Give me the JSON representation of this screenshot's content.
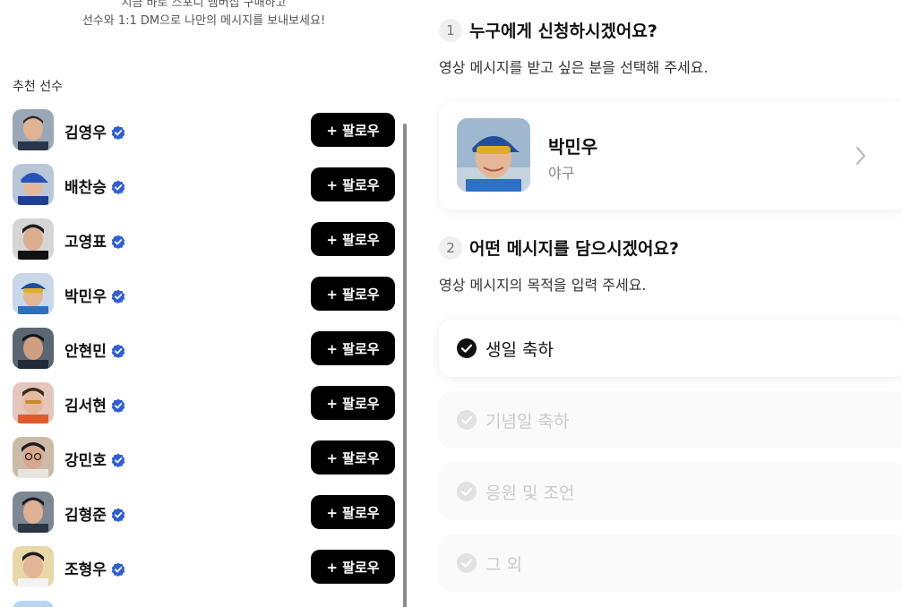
{
  "promo": {
    "line1": "지금 바로 스포디 멤버십 구매하고",
    "line2": "선수와 1:1 DM으로 나만의 메시지를 보내보세요!"
  },
  "recommended": {
    "label": "추천 선수",
    "follow_label": "+ 팔로우",
    "players": [
      {
        "name": "김영우"
      },
      {
        "name": "배찬승"
      },
      {
        "name": "고영표"
      },
      {
        "name": "박민우"
      },
      {
        "name": "안현민"
      },
      {
        "name": "김서현"
      },
      {
        "name": "강민호"
      },
      {
        "name": "김형준"
      },
      {
        "name": "조형우"
      }
    ]
  },
  "step1": {
    "number": "1",
    "title": "누구에게 신청하시겠어요?",
    "desc": "영상 메시지를 받고 싶은 분을 선택해 주세요.",
    "recipient": {
      "name": "박민우",
      "sport": "야구"
    }
  },
  "step2": {
    "number": "2",
    "title": "어떤 메시지를 담으시겠어요?",
    "desc": "영상 메시지의 목적을 입력 주세요.",
    "options": [
      {
        "label": "생일 축하",
        "selected": true
      },
      {
        "label": "기념일 축하",
        "selected": false
      },
      {
        "label": "응원 및 조언",
        "selected": false
      },
      {
        "label": "그 외",
        "selected": false
      }
    ]
  },
  "colors": {
    "verified": "#2f5fd6",
    "button_bg": "#000000",
    "muted": "#c9c9c9"
  }
}
